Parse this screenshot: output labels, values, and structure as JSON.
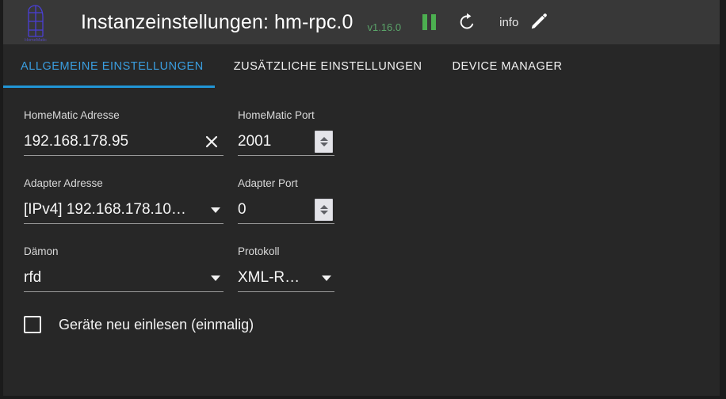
{
  "header": {
    "logo_name": "homematic-logo",
    "title": "Instanzeinstellungen: hm-rpc.0",
    "version": "v1.16.0",
    "pause_icon": "pause-icon",
    "refresh_icon": "refresh-icon",
    "info_label": "info",
    "edit_icon": "pencil-icon",
    "colors": {
      "bar_bg": "#383838",
      "version_green": "#5aa469",
      "pause_green": "#4caf50",
      "title_text": "#ffffff"
    }
  },
  "tabs": {
    "items": [
      {
        "label": "ALLGEMEINE EINSTELLUNGEN",
        "active": true
      },
      {
        "label": "ZUSÄTZLICHE EINSTELLUNGEN",
        "active": false
      },
      {
        "label": "DEVICE MANAGER",
        "active": false
      }
    ],
    "active_color": "#3a9ee0",
    "inactive_color": "#f2f2f2",
    "underline_color": "#2196d6"
  },
  "form": {
    "fields": {
      "homematic_address": {
        "label": "HomeMatic Adresse",
        "value": "192.168.178.95",
        "clear_icon": "close-icon"
      },
      "homematic_port": {
        "label": "HomeMatic Port",
        "value": "2001",
        "spinner_icon": "updown-spinner-icon"
      },
      "adapter_address": {
        "label": "Adapter Adresse",
        "value": "[IPv4] 192.168.178.10…",
        "caret_icon": "chevron-down-icon"
      },
      "adapter_port": {
        "label": "Adapter Port",
        "value": "0",
        "spinner_icon": "updown-spinner-icon"
      },
      "daemon": {
        "label": "Dämon",
        "value": "rfd",
        "caret_icon": "chevron-down-icon"
      },
      "protocol": {
        "label": "Protokoll",
        "value": "XML-R…",
        "caret_icon": "chevron-down-icon"
      }
    },
    "checkbox": {
      "label": "Geräte neu einlesen (einmalig)",
      "checked": false
    }
  },
  "theme": {
    "content_bg": "#272727",
    "field_underline": "#9a9a9a",
    "label_text": "#d9d9d9",
    "value_text": "#f5f5f5"
  }
}
